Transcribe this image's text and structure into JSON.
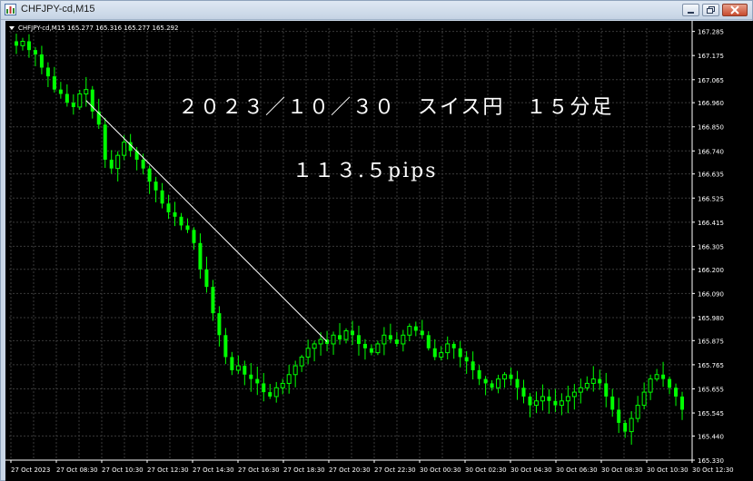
{
  "window": {
    "title": "CHFJPY-cd,M15",
    "colors": {
      "background": "#000000",
      "grid": "#3a3a3a",
      "text": "#ffffff",
      "candle": "#00ff00",
      "trendline": "#ffffff"
    },
    "icons": [
      "chart-app-icon",
      "minimize-icon",
      "restore-icon",
      "close-icon",
      "symbol-dropdown-icon"
    ]
  },
  "chart": {
    "info_label": "CHFJPY-cd,M15  165.277 165.316 165.277 165.292",
    "annotation_title": "２０２３／１０／３０　スイス円　１５分足",
    "annotation_pips": "１１３.５pips"
  },
  "chart_data": {
    "type": "candlestick",
    "symbol": "CHFJPY-cd",
    "timeframe": "M15",
    "ohlc_header": {
      "open": 165.277,
      "high": 165.316,
      "low": 165.277,
      "close": 165.292
    },
    "ylim": [
      165.33,
      167.3
    ],
    "y_ticks": [
      "167.285",
      "167.175",
      "167.065",
      "166.960",
      "166.850",
      "166.740",
      "166.635",
      "166.525",
      "166.415",
      "166.305",
      "166.200",
      "166.090",
      "165.980",
      "165.875",
      "165.765",
      "165.655",
      "165.545",
      "165.440",
      "165.330"
    ],
    "x_ticks": [
      "27 Oct 2023",
      "27 Oct 08:30",
      "27 Oct 10:30",
      "27 Oct 12:30",
      "27 Oct 14:30",
      "27 Oct 16:30",
      "27 Oct 18:30",
      "27 Oct 20:30",
      "27 Oct 22:30",
      "30 Oct 00:30",
      "30 Oct 02:30",
      "30 Oct 04:30",
      "30 Oct 06:30",
      "30 Oct 08:30",
      "30 Oct 10:30",
      "30 Oct 12:30"
    ],
    "trendline": {
      "from_price": 166.97,
      "to_price": 165.87,
      "label": "113.5pips"
    },
    "closes": [
      167.22,
      167.24,
      167.2,
      167.18,
      167.12,
      167.08,
      167.02,
      167.0,
      166.96,
      166.94,
      167.0,
      167.02,
      166.92,
      166.86,
      166.7,
      166.66,
      166.72,
      166.78,
      166.74,
      166.7,
      166.66,
      166.6,
      166.56,
      166.5,
      166.46,
      166.44,
      166.4,
      166.38,
      166.32,
      166.2,
      166.12,
      166.0,
      165.9,
      165.8,
      165.74,
      165.76,
      165.72,
      165.7,
      165.68,
      165.64,
      165.62,
      165.66,
      165.68,
      165.72,
      165.76,
      165.8,
      165.84,
      165.86,
      165.88,
      165.86,
      165.9,
      165.88,
      165.92,
      165.9,
      165.86,
      165.84,
      165.82,
      165.86,
      165.9,
      165.88,
      165.86,
      165.9,
      165.94,
      165.92,
      165.9,
      165.84,
      165.8,
      165.82,
      165.86,
      165.84,
      165.8,
      165.78,
      165.74,
      165.7,
      165.68,
      165.66,
      165.7,
      165.72,
      165.7,
      165.66,
      165.62,
      165.58,
      165.6,
      165.62,
      165.6,
      165.58,
      165.6,
      165.62,
      165.64,
      165.66,
      165.68,
      165.7,
      165.68,
      165.62,
      165.56,
      165.5,
      165.46,
      165.52,
      165.58,
      165.64,
      165.7,
      165.72,
      165.7,
      165.66,
      165.62,
      165.56
    ]
  }
}
